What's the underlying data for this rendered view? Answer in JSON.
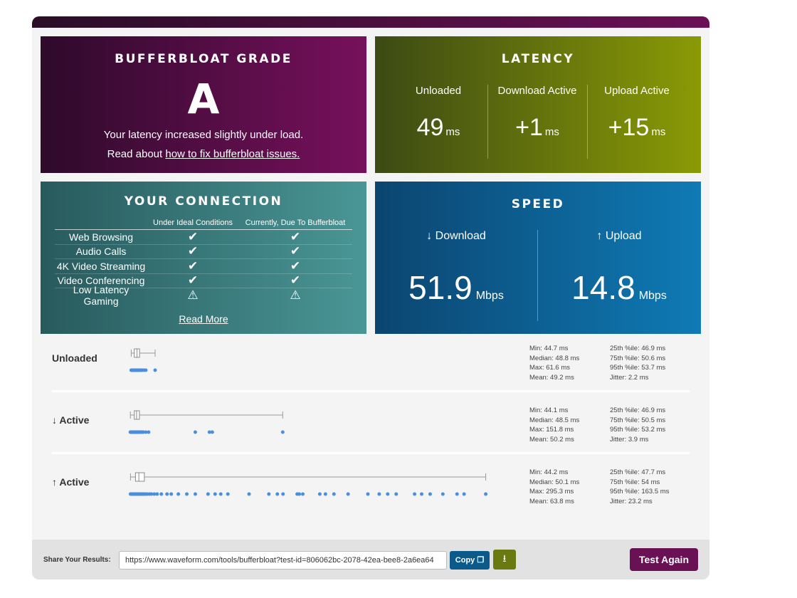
{
  "grade": {
    "title": "BUFFERBLOAT GRADE",
    "letter": "A",
    "line1": "Your latency increased slightly under load.",
    "line2_prefix": "Read about ",
    "line2_link": "how to fix bufferbloat issues."
  },
  "latency": {
    "title": "LATENCY",
    "columns": [
      {
        "label": "Unloaded",
        "value": "49",
        "unit": "ms"
      },
      {
        "label": "Download Active",
        "value": "+1",
        "unit": "ms"
      },
      {
        "label": "Upload Active",
        "value": "+15",
        "unit": "ms"
      }
    ]
  },
  "connection": {
    "title": "YOUR CONNECTION",
    "header": [
      "",
      "Under Ideal Conditions",
      "Currently, Due To Bufferbloat"
    ],
    "rows": [
      {
        "name": "Web Browsing",
        "ideal": "check",
        "current": "check"
      },
      {
        "name": "Audio Calls",
        "ideal": "check",
        "current": "check"
      },
      {
        "name": "4K Video Streaming",
        "ideal": "check",
        "current": "check"
      },
      {
        "name": "Video Conferencing",
        "ideal": "check",
        "current": "check"
      },
      {
        "name": "Low Latency Gaming",
        "ideal": "warning",
        "current": "warning"
      }
    ],
    "read_more": "Read More"
  },
  "speed": {
    "title": "SPEED",
    "download": {
      "label": "↓ Download",
      "value": "51.9",
      "unit": "Mbps"
    },
    "upload": {
      "label": "↑ Upload",
      "value": "14.8",
      "unit": "Mbps"
    }
  },
  "latency_details": [
    {
      "label": "Unloaded",
      "box": {
        "min": 44.7,
        "q1": 46.9,
        "median": 48.8,
        "q3": 50.6,
        "max": 61.6
      },
      "samples": [
        44.7,
        45,
        45.2,
        45.5,
        45.7,
        46,
        46.2,
        46.4,
        46.6,
        46.8,
        47,
        47.2,
        47.4,
        47.6,
        47.8,
        48,
        48.2,
        48.4,
        48.6,
        48.8,
        49,
        49.2,
        49.4,
        49.6,
        49.8,
        50,
        50.2,
        50.4,
        50.6,
        50.8,
        51.2,
        51.8,
        52.5,
        53.7,
        55,
        61.6
      ],
      "stats_left": [
        "Min: 44.7 ms",
        "Median: 48.8 ms",
        "Max: 61.6 ms",
        "Mean: 49.2 ms"
      ],
      "stats_right": [
        "25th %ile: 46.9 ms",
        "75th %ile: 50.6 ms",
        "95th %ile: 53.7 ms",
        "Jitter: 2.2 ms"
      ]
    },
    {
      "label": "↓ Active",
      "box": {
        "min": 44.1,
        "q1": 46.9,
        "median": 48.5,
        "q3": 50.5,
        "max": 151.8
      },
      "samples": [
        44.1,
        44.6,
        45,
        45.4,
        45.8,
        46.2,
        46.6,
        47,
        47.4,
        47.8,
        48.2,
        48.6,
        49,
        49.4,
        49.8,
        50.2,
        50.6,
        51,
        51.6,
        52.5,
        53.2,
        55,
        57,
        90,
        100,
        102,
        151.8
      ],
      "stats_left": [
        "Min: 44.1 ms",
        "Median: 48.5 ms",
        "Max: 151.8 ms",
        "Mean: 50.2 ms"
      ],
      "stats_right": [
        "25th %ile: 46.9 ms",
        "75th %ile: 50.5 ms",
        "95th %ile: 53.2 ms",
        "Jitter: 3.9 ms"
      ]
    },
    {
      "label": "↑ Active",
      "box": {
        "min": 44.2,
        "q1": 47.7,
        "median": 50.1,
        "q3": 54,
        "max": 295.3
      },
      "samples": [
        44.2,
        44.8,
        45.4,
        46,
        46.6,
        47.2,
        47.8,
        48.4,
        49,
        49.6,
        50.2,
        50.8,
        51.4,
        52,
        52.6,
        53.2,
        54,
        55,
        56,
        57.5,
        59,
        61,
        63,
        66,
        70,
        73,
        78,
        84,
        90,
        99,
        104,
        108,
        113,
        128,
        142,
        148,
        152,
        162,
        163.5,
        166,
        178,
        182,
        188,
        198,
        212,
        220,
        226,
        232,
        245,
        250,
        256,
        265,
        275,
        280,
        295.3
      ],
      "stats_left": [
        "Min: 44.2 ms",
        "Median: 50.1 ms",
        "Max: 295.3 ms",
        "Mean: 63.8 ms"
      ],
      "stats_right": [
        "25th %ile: 47.7 ms",
        "75th %ile: 54 ms",
        "95th %ile: 163.5 ms",
        "Jitter: 23.2 ms"
      ]
    }
  ],
  "footer": {
    "share_label": "Share Your Results:",
    "share_url": "https://www.waveform.com/tools/bufferbloat?test-id=806062bc-2078-42ea-bee8-2a6ea64",
    "copy_label": "Copy",
    "test_again_label": "Test Again"
  },
  "colors": {
    "grade_bg": "#5a0f4c",
    "latency_bg": "#6f7f0a",
    "connection_bg": "#357878",
    "speed_bg": "#0b5e95",
    "sample_dot": "#4a8fdc",
    "test_again_bg": "#6a1055"
  }
}
